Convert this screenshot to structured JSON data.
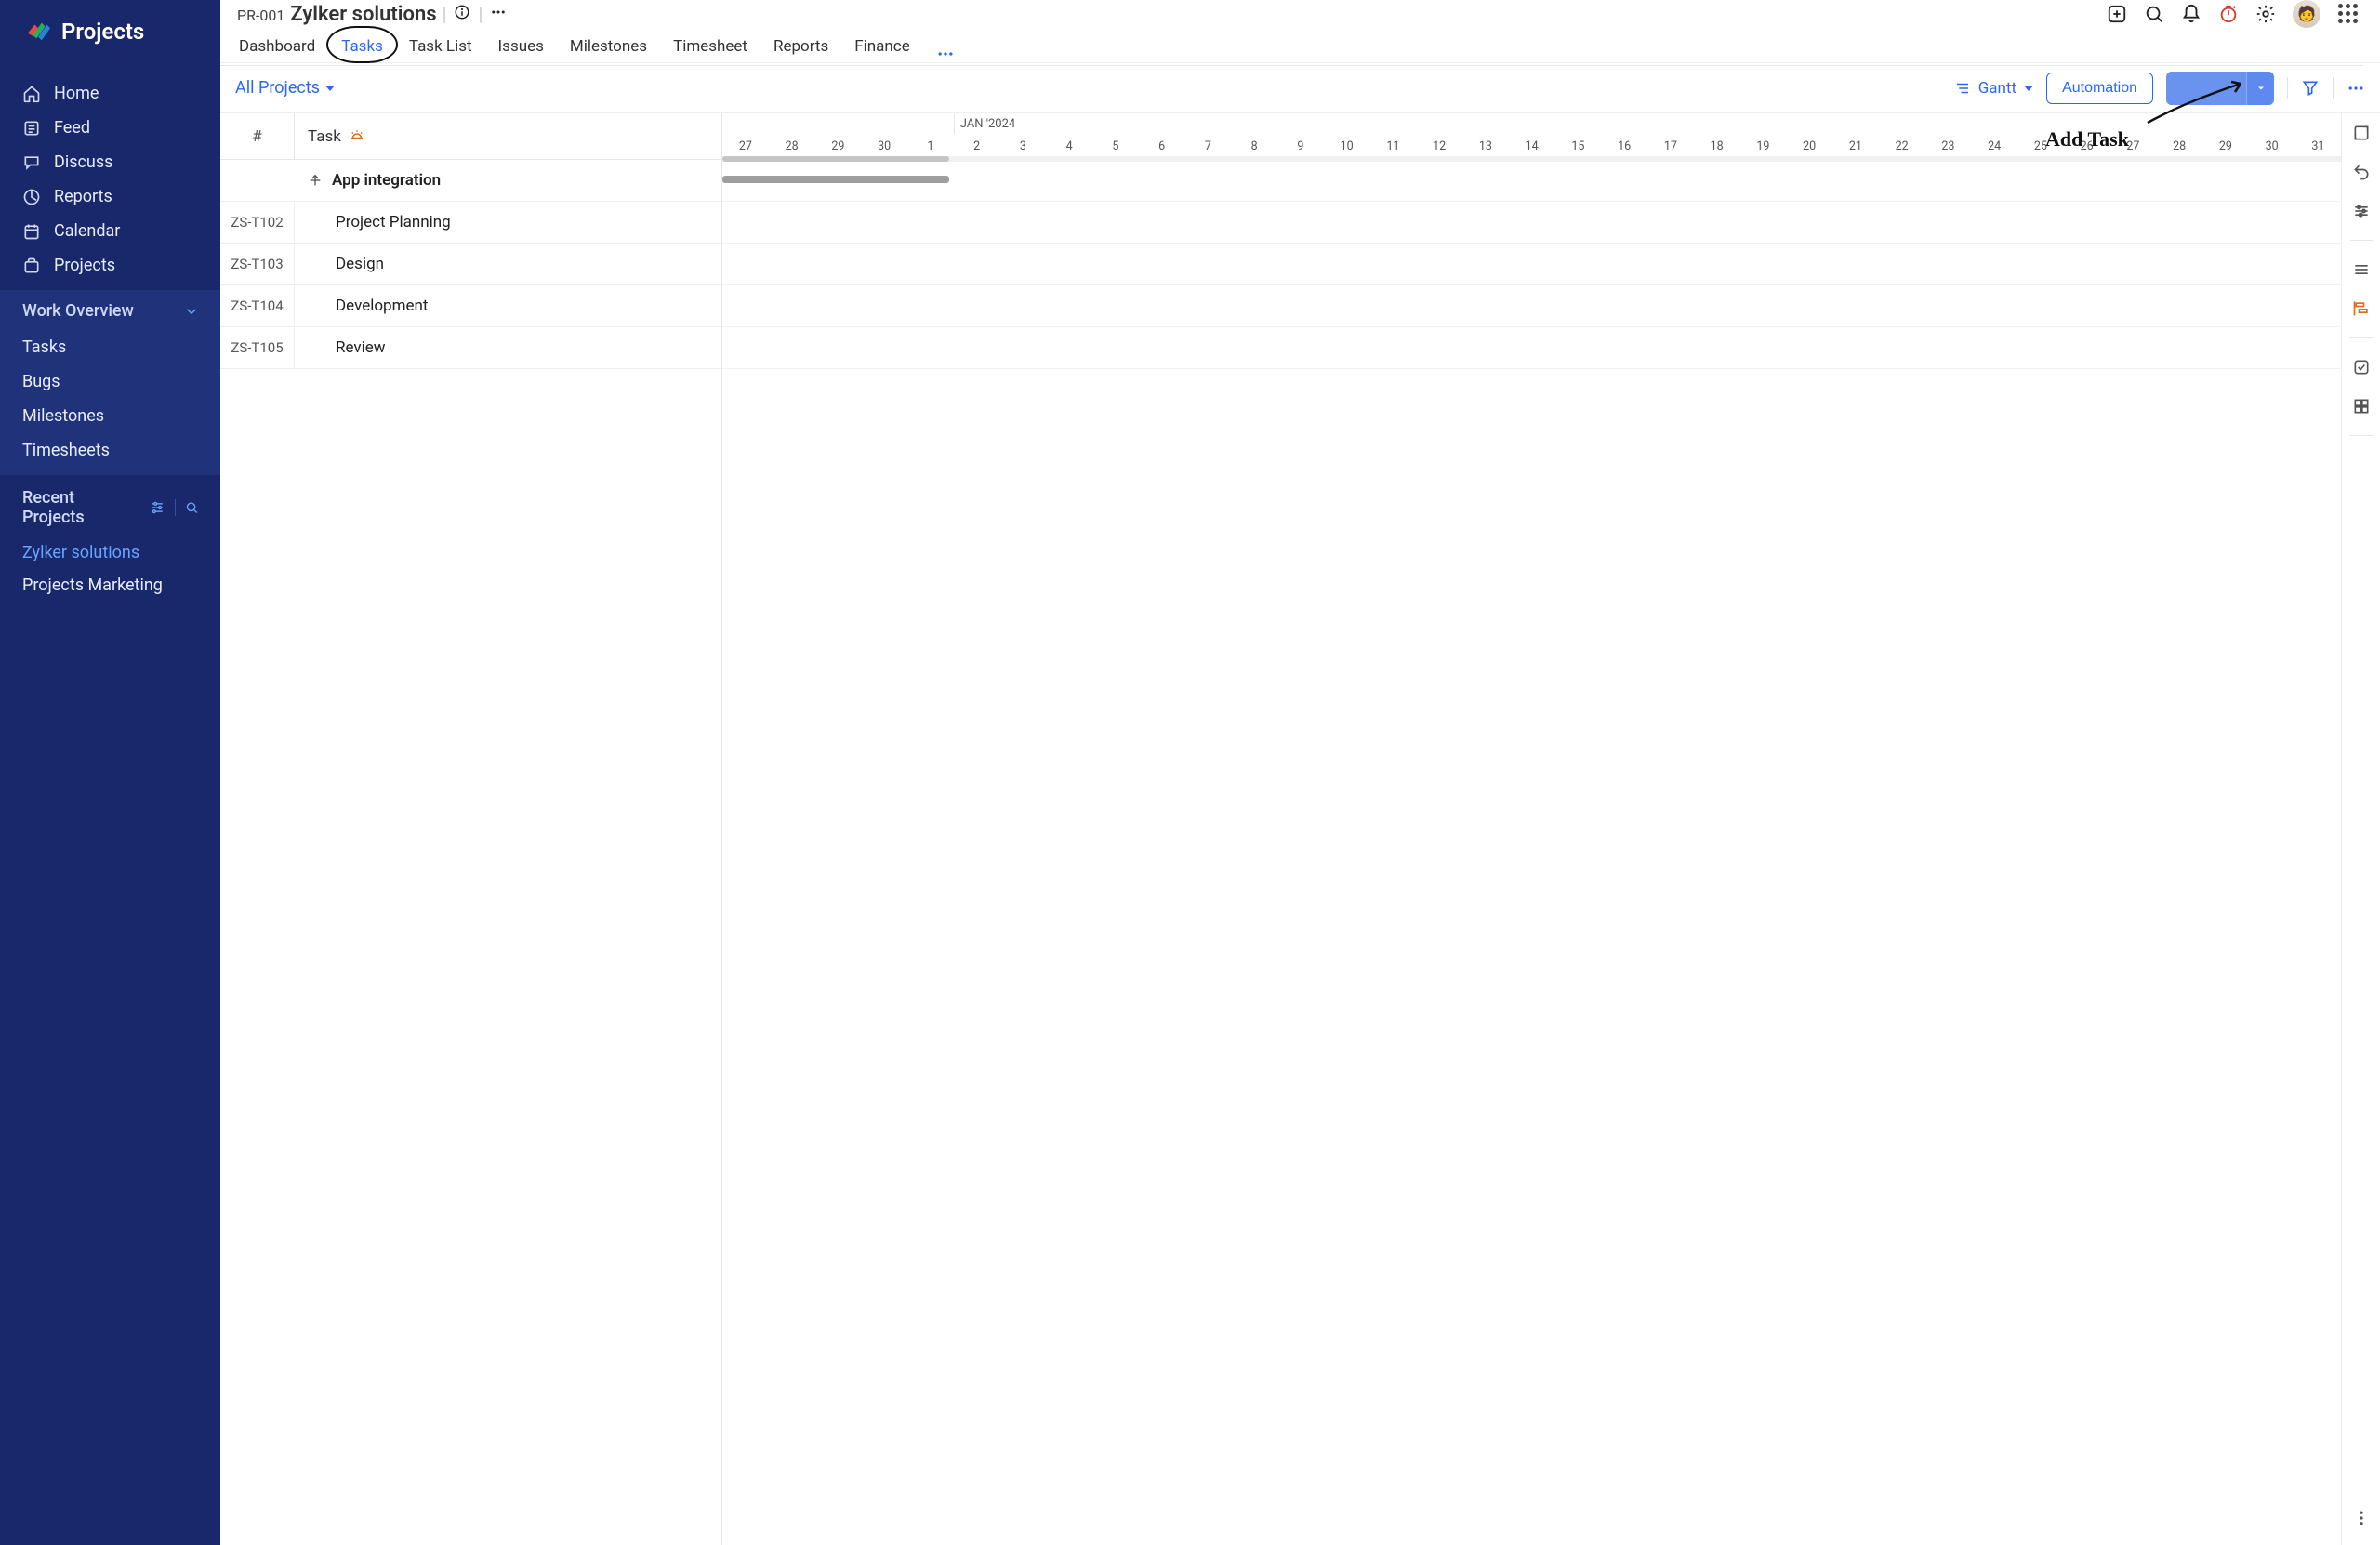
{
  "app_name": "Projects",
  "header": {
    "project_code": "PR-001",
    "project_name": "Zylker solutions"
  },
  "tabs": {
    "items": [
      "Dashboard",
      "Tasks",
      "Task List",
      "Issues",
      "Milestones",
      "Timesheet",
      "Reports",
      "Finance"
    ],
    "active_index": 1
  },
  "toolbar": {
    "filter_label": "All Projects",
    "view_label": "Gantt",
    "automation_label": "Automation"
  },
  "annotation": {
    "text": "Add Task"
  },
  "sidebar_main": {
    "items": [
      {
        "icon": "home",
        "label": "Home"
      },
      {
        "icon": "feed",
        "label": "Feed"
      },
      {
        "icon": "discuss",
        "label": "Discuss"
      },
      {
        "icon": "reports",
        "label": "Reports"
      },
      {
        "icon": "calendar",
        "label": "Calendar"
      },
      {
        "icon": "projects",
        "label": "Projects"
      }
    ]
  },
  "work_overview": {
    "title": "Work Overview",
    "items": [
      "Tasks",
      "Bugs",
      "Milestones",
      "Timesheets"
    ]
  },
  "recent_projects": {
    "title": "Recent Projects",
    "items": [
      {
        "label": "Zylker solutions",
        "active": true
      },
      {
        "label": "Projects Marketing",
        "active": false
      }
    ]
  },
  "gantt": {
    "header_number": "#",
    "header_task": "Task",
    "month_pre_count": 5,
    "month_label": "JAN '2024",
    "days": [
      "27",
      "28",
      "29",
      "30",
      "1",
      "2",
      "3",
      "4",
      "5",
      "6",
      "7",
      "8",
      "9",
      "10",
      "11",
      "12",
      "13",
      "14",
      "15",
      "16",
      "17",
      "18",
      "19",
      "20",
      "21",
      "22",
      "23",
      "24",
      "25",
      "26",
      "27",
      "28",
      "29",
      "30",
      "31"
    ],
    "group": "App integration",
    "rows": [
      {
        "id": "ZS-T102",
        "name": "Project Planning"
      },
      {
        "id": "ZS-T103",
        "name": "Design"
      },
      {
        "id": "ZS-T104",
        "name": "Development"
      },
      {
        "id": "ZS-T105",
        "name": "Review"
      }
    ]
  }
}
